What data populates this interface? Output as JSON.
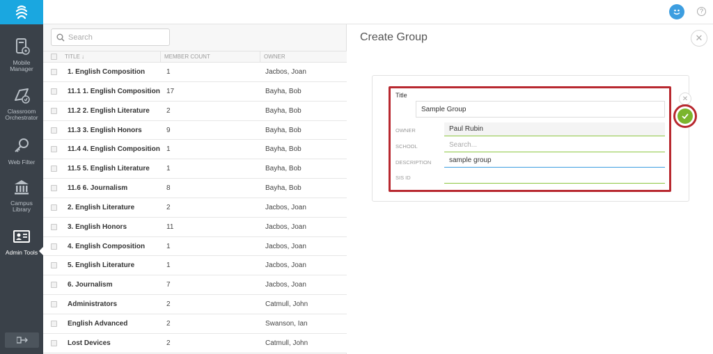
{
  "sidebar": {
    "items": [
      {
        "label1": "Mobile",
        "label2": "Manager",
        "icon": "mobile-manager-icon"
      },
      {
        "label1": "Classroom",
        "label2": "Orchestrator",
        "icon": "classroom-orchestrator-icon"
      },
      {
        "label1": "Web Filter",
        "label2": "",
        "icon": "key-icon"
      },
      {
        "label1": "Campus",
        "label2": "Library",
        "icon": "library-icon"
      },
      {
        "label1": "Admin Tools",
        "label2": "",
        "icon": "admin-tools-icon"
      }
    ],
    "active": "Admin Tools"
  },
  "search": {
    "placeholder": "Search"
  },
  "table": {
    "columns": [
      "TITLE",
      "MEMBER COUNT",
      "OWNER"
    ],
    "rows": [
      {
        "title": "1. English Composition",
        "count": "1",
        "owner": "Jacbos, Joan"
      },
      {
        "title": "11.1 1. English Composition",
        "count": "17",
        "owner": "Bayha, Bob"
      },
      {
        "title": "11.2 2. English Literature",
        "count": "2",
        "owner": "Bayha, Bob"
      },
      {
        "title": "11.3 3. English Honors",
        "count": "9",
        "owner": "Bayha, Bob"
      },
      {
        "title": "11.4 4. English Composition",
        "count": "1",
        "owner": "Bayha, Bob"
      },
      {
        "title": "11.5 5. English Literature",
        "count": "1",
        "owner": "Bayha, Bob"
      },
      {
        "title": "11.6 6. Journalism",
        "count": "8",
        "owner": "Bayha, Bob"
      },
      {
        "title": "2. English Literature",
        "count": "2",
        "owner": "Jacbos, Joan"
      },
      {
        "title": "3. English Honors",
        "count": "11",
        "owner": "Jacbos, Joan"
      },
      {
        "title": "4. English Composition",
        "count": "1",
        "owner": "Jacbos, Joan"
      },
      {
        "title": "5. English Literature",
        "count": "1",
        "owner": "Jacbos, Joan"
      },
      {
        "title": "6. Journalism",
        "count": "7",
        "owner": "Jacbos, Joan"
      },
      {
        "title": "Administrators",
        "count": "2",
        "owner": "Catmull, John"
      },
      {
        "title": "English Advanced",
        "count": "2",
        "owner": "Swanson, Ian"
      },
      {
        "title": "Lost Devices",
        "count": "2",
        "owner": "Catmull, John"
      }
    ]
  },
  "detail": {
    "title": "Create Group",
    "form": {
      "title_label": "Title",
      "title_value": "Sample Group",
      "owner_label": "OWNER",
      "owner_value": "Paul Rubin",
      "school_label": "SCHOOL",
      "school_placeholder": "Search...",
      "description_label": "DESCRIPTION",
      "description_value": "sample group",
      "sis_label": "SIS ID",
      "sis_value": ""
    }
  },
  "colors": {
    "sidebar_bg": "#3a4149",
    "brand_blue": "#1aa7e0",
    "save_green": "#7bb52d",
    "highlight_red": "#b8282f",
    "field_underline": "#8cc63f"
  }
}
